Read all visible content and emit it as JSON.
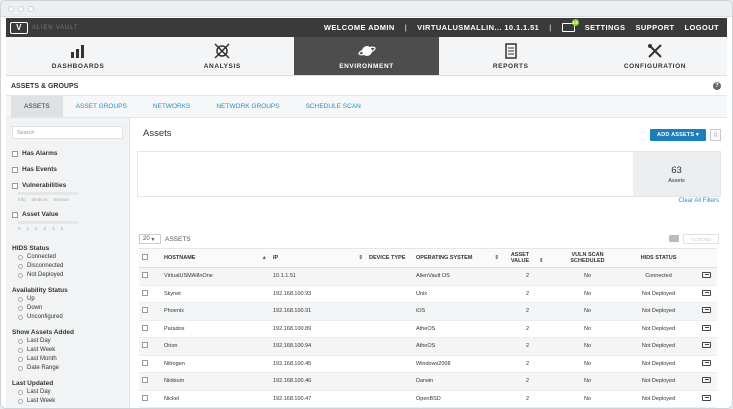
{
  "topbar": {
    "brand": "ALIEN VAULT",
    "welcome": "WELCOME ADMIN",
    "server": "VIRTUALUSMALLIN... 10.1.1.51",
    "sep": "|",
    "mail_count": "15",
    "links": [
      "SETTINGS",
      "SUPPORT",
      "LOGOUT"
    ]
  },
  "nav": [
    {
      "label": "DASHBOARDS",
      "icon": "bar-chart-icon",
      "active": false
    },
    {
      "label": "ANALYSIS",
      "icon": "crosshair-icon",
      "active": false
    },
    {
      "label": "ENVIRONMENT",
      "icon": "planet-icon",
      "active": true
    },
    {
      "label": "REPORTS",
      "icon": "report-icon",
      "active": false
    },
    {
      "label": "CONFIGURATION",
      "icon": "tools-icon",
      "active": false
    }
  ],
  "section_title": "ASSETS & GROUPS",
  "help": "?",
  "tabs": [
    "ASSETS",
    "ASSET GROUPS",
    "NETWORKS",
    "NETWORK GROUPS",
    "SCHEDULE SCAN"
  ],
  "sidebar": {
    "search_placeholder": "Search",
    "has_alarms": "Has Alarms",
    "has_events": "Has Events",
    "vulnerabilities": "Vulnerabilities",
    "vuln_levels": [
      "Info",
      "Medium",
      "Serious"
    ],
    "asset_value": "Asset Value",
    "asset_value_ticks": [
      "0",
      "1",
      "2",
      "3",
      "4",
      "5"
    ],
    "hids_status": {
      "title": "HIDS Status",
      "options": [
        "Connected",
        "Disconnected",
        "Not Deployed"
      ]
    },
    "availability": {
      "title": "Availability Status",
      "options": [
        "Up",
        "Down",
        "Unconfigured"
      ]
    },
    "show_added": {
      "title": "Show Assets Added",
      "options": [
        "Last Day",
        "Last Week",
        "Last Month",
        "Date Range"
      ]
    },
    "last_updated": {
      "title": "Last Updated",
      "options": [
        "Last Day",
        "Last Week"
      ]
    }
  },
  "main": {
    "title": "Assets",
    "add_button": "ADD ASSETS",
    "stat_value": "63",
    "stat_label": "Assets",
    "clear_filters": "Clear All Filters",
    "page_size": "20",
    "page_size_label": "ASSETS",
    "actions_label": "ACTIONS"
  },
  "table": {
    "headers": [
      "HOSTNAME",
      "IP",
      "DEVICE TYPE",
      "OPERATING SYSTEM",
      "ASSET VALUE",
      "VULN SCAN SCHEDULED",
      "HIDS STATUS"
    ],
    "rows": [
      [
        "VirtualUSMAllInOne",
        "10.1.1.51",
        "",
        "AlienVault OS",
        "2",
        "No",
        "Connected"
      ],
      [
        "Skynet",
        "192.168.100.93",
        "",
        "Unix",
        "2",
        "No",
        "Not Deployed"
      ],
      [
        "Phoenix",
        "192.168.100.91",
        "",
        "iOS",
        "2",
        "No",
        "Not Deployed"
      ],
      [
        "Paradox",
        "192.168.100.89",
        "",
        "AtheOS",
        "2",
        "No",
        "Not Deployed"
      ],
      [
        "Orion",
        "192.168.100.94",
        "",
        "AtheOS",
        "2",
        "No",
        "Not Deployed"
      ],
      [
        "Nitrogen",
        "192.168.100.45",
        "",
        "Windows2008",
        "2",
        "No",
        "Not Deployed"
      ],
      [
        "Niobium",
        "192.168.100.46",
        "",
        "Darwin",
        "2",
        "No",
        "Not Deployed"
      ],
      [
        "Nickel",
        "192.168.100.47",
        "",
        "OpenBSD",
        "2",
        "No",
        "Not Deployed"
      ]
    ]
  }
}
